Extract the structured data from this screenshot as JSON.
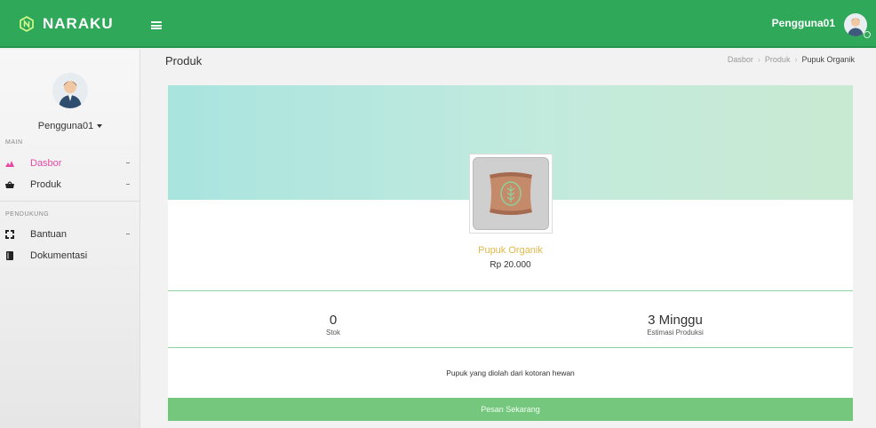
{
  "brand": {
    "name": "NARAKU",
    "icon": "naraku-logo-icon"
  },
  "topbar": {
    "username": "Pengguna01",
    "menu_icon": "hamburger-icon",
    "avatar_icon": "user-avatar-icon"
  },
  "sidebar": {
    "username": "Pengguna01",
    "sections": [
      {
        "label": "MAIN",
        "items": [
          {
            "label": "Dasbor",
            "icon": "dashboard-icon",
            "active": true
          },
          {
            "label": "Produk",
            "icon": "basket-icon"
          }
        ]
      },
      {
        "label": "PENDUKUNG",
        "items": [
          {
            "label": "Bantuan",
            "icon": "expand-icon"
          },
          {
            "label": "Dokumentasi",
            "icon": "book-icon"
          }
        ]
      }
    ]
  },
  "page": {
    "title": "Produk",
    "breadcrumb": [
      "Dasbor",
      "Produk",
      "Pupuk Organik"
    ]
  },
  "product": {
    "name": "Pupuk Organik",
    "price": "Rp 20.000",
    "image_icon": "fertilizer-sack-icon",
    "stock_value": "0",
    "stock_label": "Stok",
    "estimate_value": "3 Minggu",
    "estimate_label": "Estimasi Produksi",
    "description": "Pupuk yang diolah dari kotoran hewan",
    "order_button": "Pesan Sekarang"
  },
  "colors": {
    "primary": "#2fa85a",
    "active_nav": "#e64aa6",
    "product_name": "#e0b84a",
    "order_button": "#74c77d"
  }
}
